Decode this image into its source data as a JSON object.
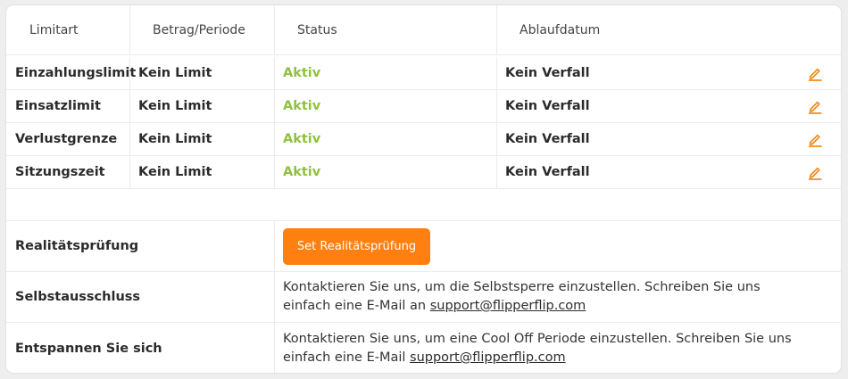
{
  "columns": [
    "Limitart",
    "Betrag/Periode",
    "Status",
    "Ablaufdatum"
  ],
  "limits": [
    {
      "type": "Einzahlungslimit",
      "amount": "Kein Limit",
      "status": "Aktiv",
      "expiry": "Kein Verfall"
    },
    {
      "type": "Einsatzlimit",
      "amount": "Kein Limit",
      "status": "Aktiv",
      "expiry": "Kein Verfall"
    },
    {
      "type": "Verlustgrenze",
      "amount": "Kein Limit",
      "status": "Aktiv",
      "expiry": "Kein Verfall"
    },
    {
      "type": "Sitzungszeit",
      "amount": "Kein Limit",
      "status": "Aktiv",
      "expiry": "Kein Verfall"
    }
  ],
  "reality_check": {
    "label": "Realitätsprüfung",
    "button_label": "Set Realitätsprüfung"
  },
  "self_exclusion": {
    "label": "Selbstausschluss",
    "text": "Kontaktieren Sie uns, um die Selbstsperre einzustellen. Schreiben Sie uns einfach eine E-Mail an ",
    "email": "support@flipperflip.com"
  },
  "cool_off": {
    "label": "Entspannen Sie sich",
    "text": "Kontaktieren Sie uns, um eine Cool Off Periode einzustellen. Schreiben Sie uns einfach eine E-Mail ",
    "email": "support@flipperflip.com"
  },
  "icons": {
    "edit": "pencil-edit-icon"
  },
  "colors": {
    "accent": "#ff7f10",
    "status_active": "#8fc140",
    "edit_icon": "#f08a1c"
  }
}
